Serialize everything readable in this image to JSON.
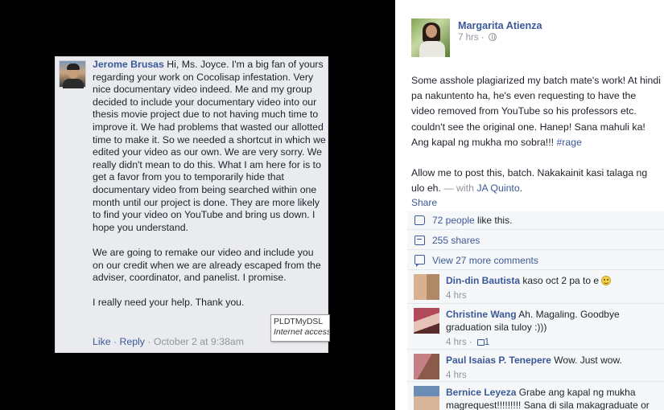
{
  "message": {
    "sender": "Jerome Brusas",
    "paragraphs": [
      "Hi, Ms. Joyce. I'm a big fan of yours regarding your work on Cocolisap infestation. Very nice documentary video indeed. Me and my group decided to include your documentary video into our thesis movie project due to not having much time to improve it. We had problems that wasted our allotted time to make it. So we needed a shortcut in which we edited your video as our own. We are very sorry. We really didn't mean to do this. What I am here for is to get a favor from you to temporarily hide that documentary video from being searched within one month until our project is done. They are more likely to find your video on YouTube and bring us down. I hope you understand.",
      "We are going to remake our video and include you on our credit when we are already escaped from the adviser, coordinator, and panelist. I promise.",
      "I really need your help. Thank you."
    ],
    "actions": {
      "like": "Like",
      "reply": "Reply",
      "sep": " · ",
      "date": "October 2 at 9:38am"
    },
    "tooltip": {
      "line1": "PLDTMyDSL",
      "line2": "Internet access"
    }
  },
  "post": {
    "author": "Margarita Atienza",
    "time": "7 hrs · ",
    "globe_icon": "globe-icon",
    "text1": "Some asshole plagiarized my batch mate's work! At hindi pa nakuntento ha, he's even requesting to have the video removed from YouTube so his professors etc. couldn't see the original one. Hanep! Sana mahuli ka! Ang kapal ng mukha mo sobra!!! ",
    "hashtag": "#rage",
    "text2": "Allow me to post this, batch. Nakakainit kasi talaga ng ulo eh.",
    "with_label": " — with ",
    "tagged": "JA Quinto",
    "tagged_end": ".",
    "share": "Share"
  },
  "stats": {
    "likes_link": "72 people",
    "likes_rest": " like this.",
    "shares": "255 shares",
    "view_more": "View 27 more comments"
  },
  "comments": [
    {
      "name": "Din-din Bautista",
      "text": " kaso oct 2 pa to e ",
      "time": "4 hrs",
      "likes": ""
    },
    {
      "name": "Christine Wang",
      "text": " Ah. Magaling. Goodbye graduation sila tuloy :)))",
      "time": "4 hrs · ",
      "likes": "1"
    },
    {
      "name": "Paul Isaias P. Tenepere",
      "text": " Wow. Just wow.",
      "time": "4 hrs",
      "likes": ""
    },
    {
      "name": "Bernice Leyeza",
      "text": " Grabe ang kapal ng mukha magrequest!!!!!!!!! Sana di sila makagraduate or",
      "time": "",
      "likes": ""
    }
  ],
  "colors": {
    "link": "#3b5998",
    "meta": "#90949c",
    "panel": "#eaebef",
    "ufi": "#f6f7f9"
  }
}
